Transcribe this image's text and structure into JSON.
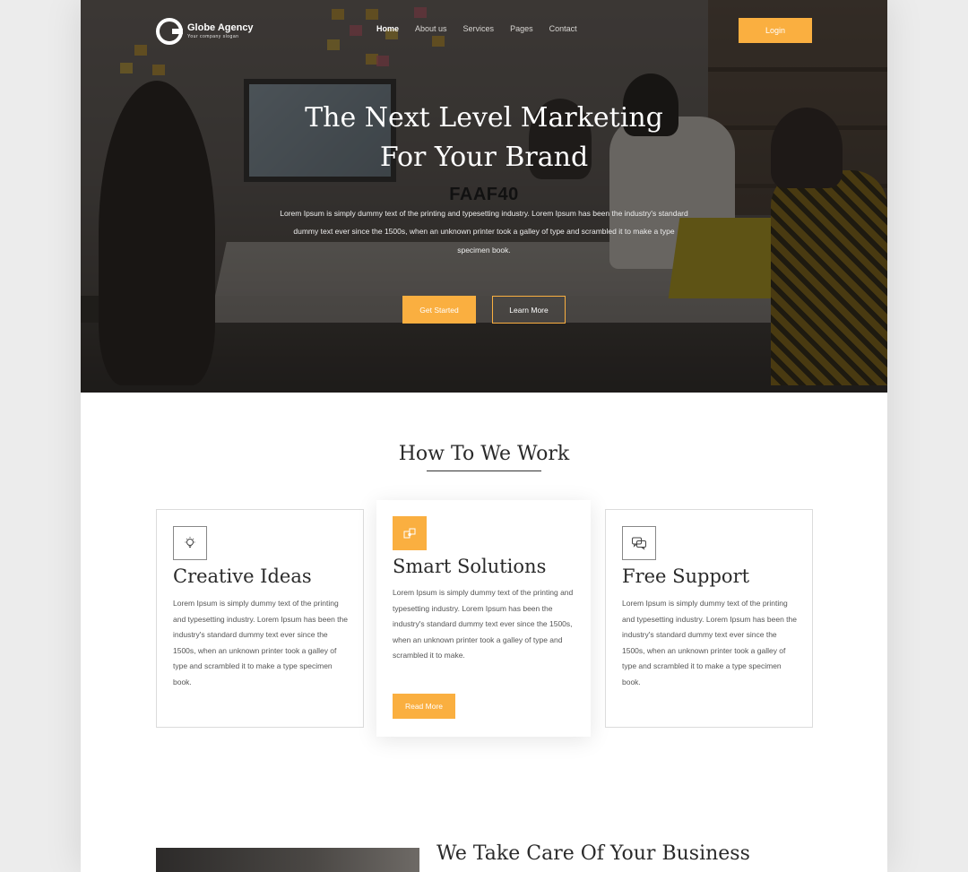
{
  "brand": {
    "name": "Globe Agency",
    "slogan": "Your company slogan"
  },
  "nav": {
    "items": [
      {
        "label": "Home",
        "active": true
      },
      {
        "label": "About us",
        "active": false
      },
      {
        "label": "Services",
        "active": false
      },
      {
        "label": "Pages",
        "active": false
      },
      {
        "label": "Contact",
        "active": false
      }
    ],
    "login_label": "Login"
  },
  "hero": {
    "title_line1": "The Next Level Marketing",
    "title_line2": "For Your Brand",
    "overlay_code": "FAAF40",
    "description": "Lorem Ipsum is simply dummy text of the printing and typesetting industry. Lorem Ipsum has been the industry's standard dummy text ever since the 1500s, when an unknown printer took a galley of type and scrambled it to make a type specimen book.",
    "primary_button": "Get Started",
    "secondary_button": "Learn More"
  },
  "work": {
    "title": "How To We Work",
    "cards": [
      {
        "icon": "lightbulb-icon",
        "title": "Creative Ideas",
        "text": "Lorem Ipsum is simply dummy text of the printing and typesetting industry. Lorem Ipsum has been the industry's standard dummy text ever since the 1500s, when an unknown printer took a galley of type and scrambled it to make a type specimen book."
      },
      {
        "icon": "puzzle-icon",
        "title": "Smart Solutions",
        "text": "Lorem Ipsum is simply dummy text of the printing and typesetting industry. Lorem Ipsum has been the industry's standard dummy text ever since the 1500s, when an unknown printer took a galley of type and scrambled it to make.",
        "button": "Read More"
      },
      {
        "icon": "chat-icon",
        "title": "Free Support",
        "text": "Lorem Ipsum is simply dummy text of the printing and typesetting industry. Lorem Ipsum has been the industry's standard dummy text ever since the 1500s, when an unknown printer took a galley of type and scrambled it to make a type specimen book."
      }
    ]
  },
  "business": {
    "title": "We Take Care Of Your Business"
  },
  "colors": {
    "accent": "#FAAF40",
    "text_dark": "#2a2a2a",
    "background": "#ececec"
  }
}
